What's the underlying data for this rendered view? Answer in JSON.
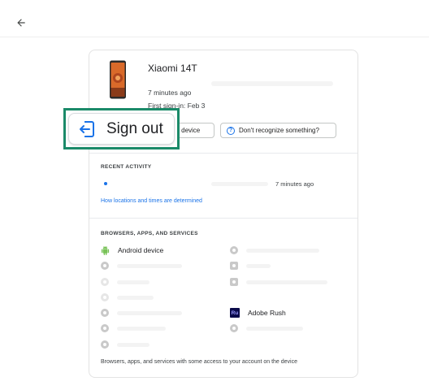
{
  "device": {
    "name": "Xiaomi 14T",
    "last_seen": "7 minutes ago",
    "first_sign_in": "First sign-in: Feb 3",
    "find_device_label": "ad device",
    "recognize_label": "Don't recognize something?"
  },
  "signout": {
    "label": "Sign out"
  },
  "recent_activity": {
    "title": "RECENT ACTIVITY",
    "time": "7 minutes ago",
    "link": "How locations and times are determined"
  },
  "apps": {
    "title": "BROWSERS, APPS, AND SERVICES",
    "android_label": "Android device",
    "adobe_label": "Adobe Rush",
    "adobe_icon_text": "Ru",
    "footnote": "Browsers, apps, and services with some access to your account on the device"
  },
  "colors": {
    "accent": "#1a73e8",
    "highlight": "#1b8a69",
    "android": "#78c257"
  },
  "icons": {
    "back": "arrow-back-icon",
    "signout": "sign-out-icon",
    "help": "help-circle-icon",
    "phone": "phone-icon"
  }
}
